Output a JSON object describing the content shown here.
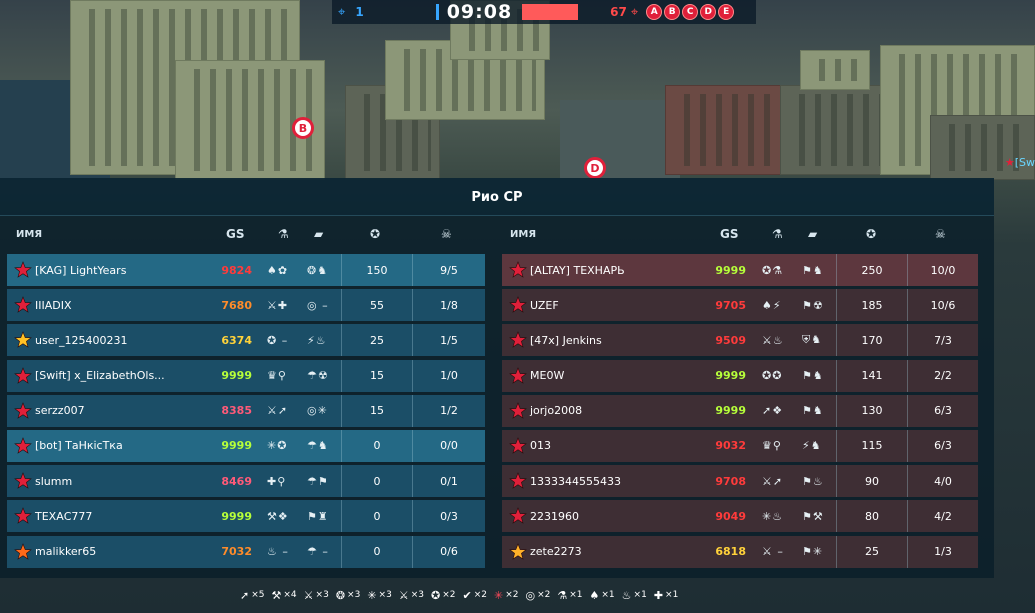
{
  "hud": {
    "blue_count": "1",
    "time": "09:08",
    "red_count": "67",
    "points": [
      "A",
      "B",
      "C",
      "D",
      "E"
    ]
  },
  "map_markers": {
    "b": "B",
    "d": "D"
  },
  "side_tag": "[Sw",
  "board": {
    "title": "Рио CP",
    "headers": {
      "name": "ИМЯ",
      "gs": "GS"
    }
  },
  "blue_team": [
    {
      "name": "[KAG] LightYears",
      "gs": "9824",
      "gs_color": "#ff3b3b",
      "mods1": "♠✿",
      "mods2": "❂♞",
      "score": "150",
      "kd": "9/5",
      "rank_color": "#e0203a"
    },
    {
      "name": "IIIADIX",
      "gs": "7680",
      "gs_color": "#ff8c2a",
      "mods1": "⚔✚",
      "mods2": "◎ –",
      "score": "55",
      "kd": "1/8",
      "rank_color": "#e0203a"
    },
    {
      "name": "user_125400231",
      "gs": "6374",
      "gs_color": "#ffd23a",
      "mods1": "✪ –",
      "mods2": "⚡♨",
      "score": "25",
      "kd": "1/5",
      "rank_color": "#ffc125"
    },
    {
      "name": "[Swift] x_ElizabethOls...",
      "gs": "9999",
      "gs_color": "#b6ff3a",
      "mods1": "♛⚲",
      "mods2": "☂☢",
      "score": "15",
      "kd": "1/0",
      "rank_color": "#e0203a"
    },
    {
      "name": "serzz007",
      "gs": "8385",
      "gs_color": "#ff5a78",
      "mods1": "⚔➚",
      "mods2": "◎✳",
      "score": "15",
      "kd": "1/2",
      "rank_color": "#e0203a"
    },
    {
      "name": "[bot] ТаНкісТка",
      "gs": "9999",
      "gs_color": "#b6ff3a",
      "mods1": "✳✪",
      "mods2": "☂♞",
      "score": "0",
      "kd": "0/0",
      "rank_color": "#e0203a"
    },
    {
      "name": "slumm",
      "gs": "8469",
      "gs_color": "#ff5a78",
      "mods1": "✚⚲",
      "mods2": "☂⚑",
      "score": "0",
      "kd": "0/1",
      "rank_color": "#e0203a"
    },
    {
      "name": "ТЕХАС777",
      "gs": "9999",
      "gs_color": "#b6ff3a",
      "mods1": "⚒❖",
      "mods2": "⚑♜",
      "score": "0",
      "kd": "0/3",
      "rank_color": "#e0203a"
    },
    {
      "name": "malikker65",
      "gs": "7032",
      "gs_color": "#ff8c2a",
      "mods1": "♨ –",
      "mods2": "☂ –",
      "score": "0",
      "kd": "0/6",
      "rank_color": "#ff6a1a"
    }
  ],
  "red_team": [
    {
      "name": "[ALTAY] ТЕХНАРЬ",
      "gs": "9999",
      "gs_color": "#b6ff3a",
      "mods1": "✪⚗",
      "mods2": "⚑♞",
      "score": "250",
      "kd": "10/0",
      "rank_color": "#e0203a"
    },
    {
      "name": "UZEF",
      "gs": "9705",
      "gs_color": "#ff3b3b",
      "mods1": "♠⚡",
      "mods2": "⚑☢",
      "score": "185",
      "kd": "10/6",
      "rank_color": "#e0203a"
    },
    {
      "name": "[47x] Jenkins",
      "gs": "9509",
      "gs_color": "#ff3b3b",
      "mods1": "⚔♨",
      "mods2": "⛨♞",
      "score": "170",
      "kd": "7/3",
      "rank_color": "#e0203a"
    },
    {
      "name": "ME0W",
      "gs": "9999",
      "gs_color": "#b6ff3a",
      "mods1": "✪✪",
      "mods2": "⚑♞",
      "score": "141",
      "kd": "2/2",
      "rank_color": "#e0203a"
    },
    {
      "name": "jorjo2008",
      "gs": "9999",
      "gs_color": "#b6ff3a",
      "mods1": "➚❖",
      "mods2": "⚑♞",
      "score": "130",
      "kd": "6/3",
      "rank_color": "#e0203a"
    },
    {
      "name": "013",
      "gs": "9032",
      "gs_color": "#ff3b3b",
      "mods1": "♛⚲",
      "mods2": "⚡♞",
      "score": "115",
      "kd": "6/3",
      "rank_color": "#e0203a"
    },
    {
      "name": "1333344555433",
      "gs": "9708",
      "gs_color": "#ff3b3b",
      "mods1": "⚔➚",
      "mods2": "⚑♨",
      "score": "90",
      "kd": "4/0",
      "rank_color": "#e0203a"
    },
    {
      "name": "2231960",
      "gs": "9049",
      "gs_color": "#ff3b3b",
      "mods1": "✳♨",
      "mods2": "⚑⚒",
      "score": "80",
      "kd": "4/2",
      "rank_color": "#e0203a"
    },
    {
      "name": "zete2273",
      "gs": "6818",
      "gs_color": "#ffd23a",
      "mods1": "⚔ –",
      "mods2": "⚑✳",
      "score": "25",
      "kd": "1/3",
      "rank_color": "#ffb12a"
    }
  ],
  "supplies": [
    {
      "icon": "➚",
      "count": "×5",
      "red": false
    },
    {
      "icon": "⚒",
      "count": "×4",
      "red": false
    },
    {
      "icon": "⚔",
      "count": "×3",
      "red": false
    },
    {
      "icon": "❂",
      "count": "×3",
      "red": false
    },
    {
      "icon": "✳",
      "count": "×3",
      "red": false
    },
    {
      "icon": "⚔",
      "count": "×3",
      "red": false
    },
    {
      "icon": "✪",
      "count": "×2",
      "red": false
    },
    {
      "icon": "✔",
      "count": "×2",
      "red": false
    },
    {
      "icon": "✳",
      "count": "×2",
      "red": true
    },
    {
      "icon": "◎",
      "count": "×2",
      "red": false
    },
    {
      "icon": "⚗",
      "count": "×1",
      "red": false
    },
    {
      "icon": "♠",
      "count": "×1",
      "red": false
    },
    {
      "icon": "♨",
      "count": "×1",
      "red": false
    },
    {
      "icon": "✚",
      "count": "×1",
      "red": false
    }
  ]
}
